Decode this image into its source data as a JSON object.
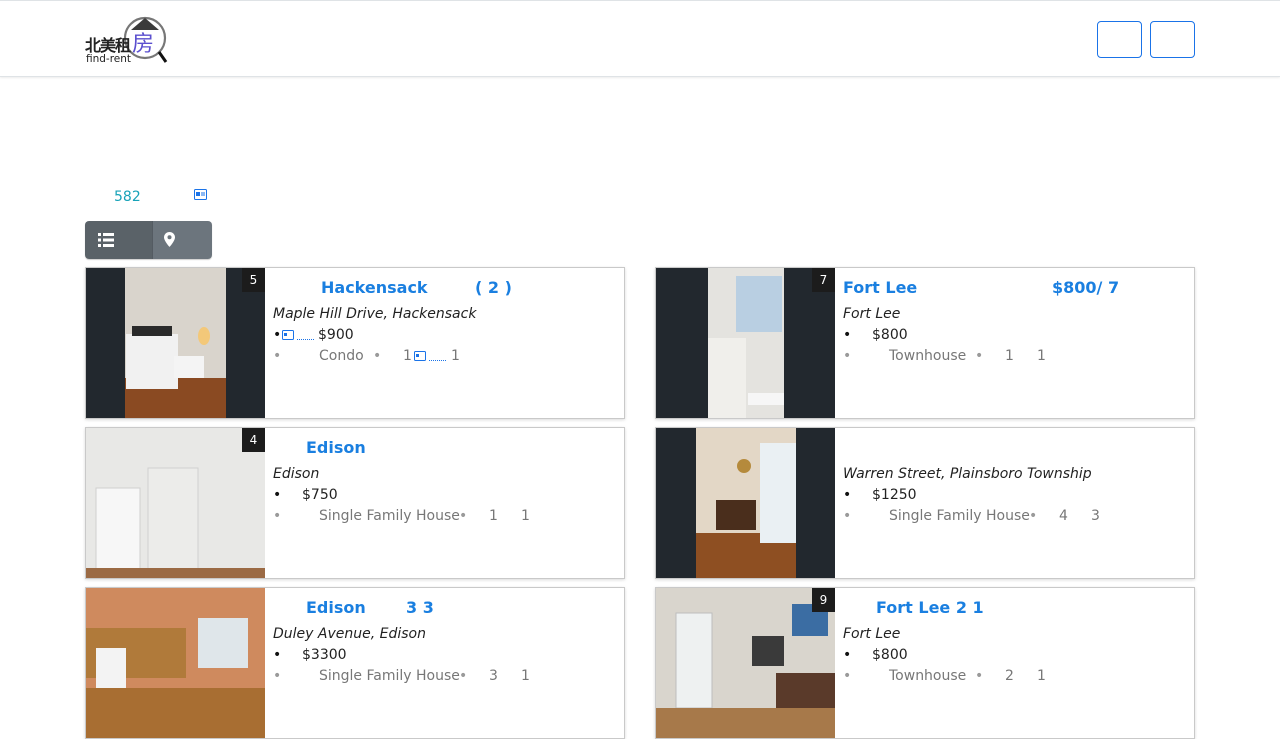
{
  "brand": {
    "cn_text": "北美租",
    "fang_char": "房",
    "en_text": "find-rent"
  },
  "listing_count": "582",
  "icons": {
    "list_view": "list-icon",
    "map_view": "map-marker-icon",
    "card": "id-card-icon"
  },
  "colors": {
    "accent": "#1a7fe0",
    "count": "#17a2b8",
    "toggle": "#6c757d"
  },
  "listings": [
    {
      "badge": "5",
      "title": "Hackensack",
      "title_extra": "( 2 )",
      "address": "Maple Hill Drive, Hackensack",
      "price": "$900",
      "type": "Condo",
      "n1": "1",
      "n2": "1"
    },
    {
      "badge": "7",
      "title": "Fort Lee",
      "title_extra": "$800/ 7",
      "address": "Fort Lee",
      "price": "$800",
      "type": "Townhouse",
      "n1": "1",
      "n2": "1"
    },
    {
      "badge": "4",
      "title": "Edison",
      "title_extra": "",
      "address": "Edison",
      "price": "$750",
      "type": "Single Family House",
      "n1": "1",
      "n2": "1"
    },
    {
      "badge": "",
      "title": "",
      "title_extra": "",
      "address": "Warren Street, Plainsboro Township",
      "price": "$1250",
      "type": "Single Family House",
      "n1": "4",
      "n2": "3"
    },
    {
      "badge": "",
      "title": "Edison",
      "title_extra": "3 3",
      "address": "Duley Avenue, Edison",
      "price": "$3300",
      "type": "Single Family House",
      "n1": "3",
      "n2": "1"
    },
    {
      "badge": "9",
      "title": "Fort Lee 2 1",
      "title_extra": "",
      "address": "Fort Lee",
      "price": "$800",
      "type": "Townhouse",
      "n1": "2",
      "n2": "1"
    }
  ]
}
